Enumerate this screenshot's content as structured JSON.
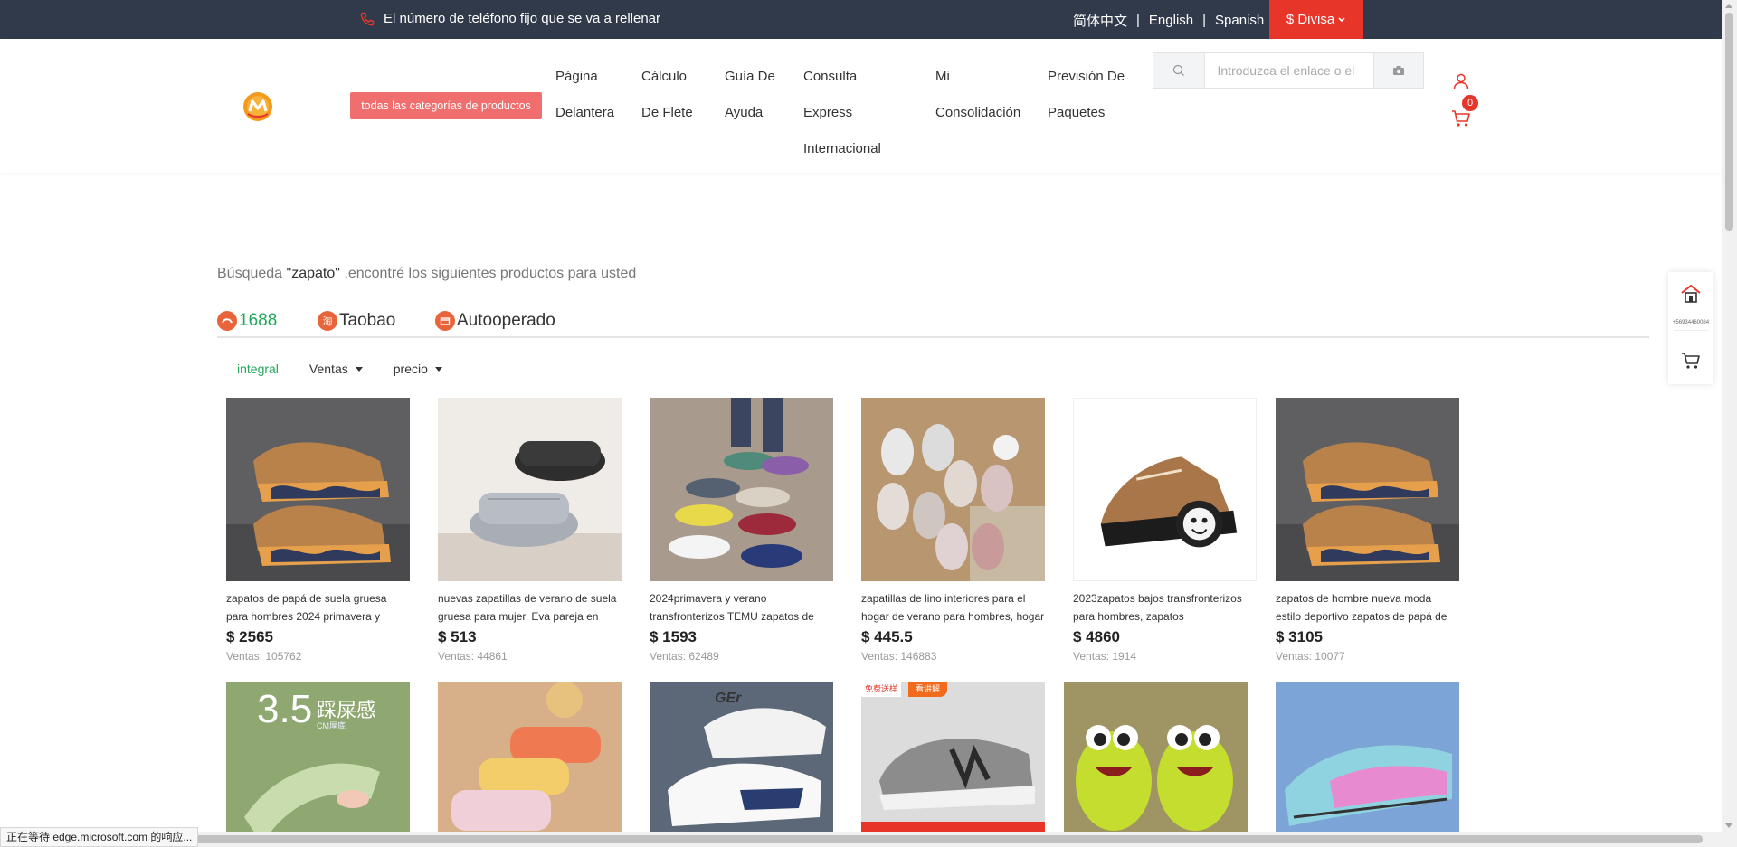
{
  "topbar": {
    "phone_text": "El número de teléfono fijo que se va a rellenar",
    "languages": [
      "简体中文",
      "English",
      "Spanish"
    ],
    "currency": "$ Divisa"
  },
  "header": {
    "category_button": "todas las categorías de productos",
    "nav": [
      {
        "lines": [
          "Página",
          "Delantera"
        ]
      },
      {
        "lines": [
          "Cálculo",
          "De Flete"
        ]
      },
      {
        "lines": [
          "Guía De",
          "Ayuda"
        ]
      },
      {
        "lines": [
          "Consulta",
          "Express",
          "Internacional"
        ]
      },
      {
        "lines": [
          "Mi",
          "Consolidación"
        ]
      },
      {
        "lines": [
          "Previsión De",
          "Paquetes"
        ]
      }
    ],
    "search_placeholder": "Introduzca el enlace o el",
    "cart_count": "0"
  },
  "results": {
    "prefix": "Búsqueda ",
    "keyword": "\"zapato\"",
    "suffix": " ,encontré los siguientes productos para usted",
    "tabs": [
      "1688",
      "Taobao",
      "Autooperado"
    ],
    "sorts": [
      "integral",
      "Ventas",
      "precio"
    ]
  },
  "products": [
    {
      "title": "zapatos de papá de suela gruesa para hombres 2024 primavera y otoño",
      "price": "$ 2565",
      "sales": "Ventas: 105762"
    },
    {
      "title": "nuevas zapatillas de verano de suela gruesa para mujer. Eva pareja en",
      "price": "$ 513",
      "sales": "Ventas: 44861"
    },
    {
      "title": "2024primavera y verano transfronterizos TEMU zapatos de",
      "price": "$ 1593",
      "sales": "Ventas: 62489"
    },
    {
      "title": "zapatillas de lino interiores para el hogar de verano para hombres, hogar",
      "price": "$ 445.5",
      "sales": "Ventas: 146883"
    },
    {
      "title": "2023zapatos bajos transfronterizos para hombres, zapatos",
      "price": "$ 4860",
      "sales": "Ventas: 1914"
    },
    {
      "title": "zapatos de hombre nueva moda estilo deportivo zapatos de papá de moda",
      "price": "$ 3105",
      "sales": "Ventas: 10077"
    }
  ],
  "row2_labels": {
    "img1": "3.5",
    "img1b": "踩屎感",
    "img1c": "CM厚底",
    "img3": "GEr",
    "badge1": "免费送样",
    "badge2": "看讲解"
  },
  "side_number": "+56934460084",
  "status_text": "正在等待 edge.microsoft.com 的响应...",
  "colors": {
    "accent_red": "#e8352a",
    "topbar": "#303a4a",
    "active_green": "#21a65a",
    "category_btn": "#f16e6e"
  }
}
